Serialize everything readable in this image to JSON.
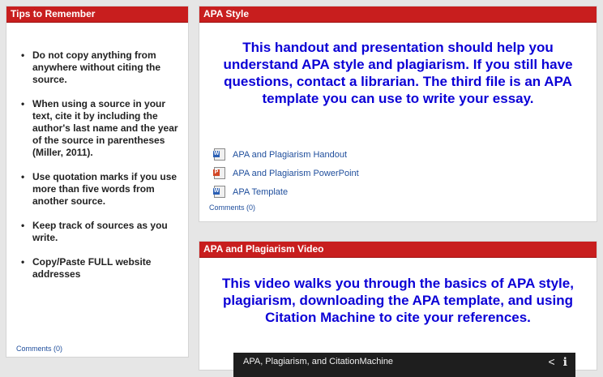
{
  "tips": {
    "title": "Tips to Remember",
    "items": [
      "Do not copy anything from anywhere without citing the source.",
      "When using a source in your text, cite it by including the author's last name and the year of the source in parentheses (Miller, 2011).",
      "Use quotation marks if you use more than five words from another source.",
      "Keep track of sources as you write.",
      "Copy/Paste FULL website addresses"
    ],
    "comments": "Comments (0)"
  },
  "apa": {
    "title": "APA Style",
    "intro": "This handout and presentation should help you understand APA style and plagiarism. If you still have questions, contact a librarian. The third file is an APA template you can use to write your essay.",
    "files": [
      {
        "label": "APA and Plagiarism Handout",
        "icon": "word-doc-icon",
        "color": "#2b5fb4"
      },
      {
        "label": "APA and Plagiarism PowerPoint",
        "icon": "powerpoint-icon",
        "color": "#d24726"
      },
      {
        "label": "APA Template",
        "icon": "word-doc-icon",
        "color": "#2b5fb4"
      }
    ],
    "comments": "Comments (0)"
  },
  "video": {
    "title": "APA and Plagiarism Video",
    "intro": "This video walks you through the basics of APA style, plagiarism, downloading the APA template, and using Citation Machine to cite your references.",
    "player_title": "APA, Plagiarism, and CitationMachine",
    "player_icons": [
      "share-icon",
      "info-icon"
    ]
  },
  "colors": {
    "header_red": "#c81e1e",
    "highlight_blue": "#0b00d6",
    "link_blue": "#1f4e9c"
  }
}
